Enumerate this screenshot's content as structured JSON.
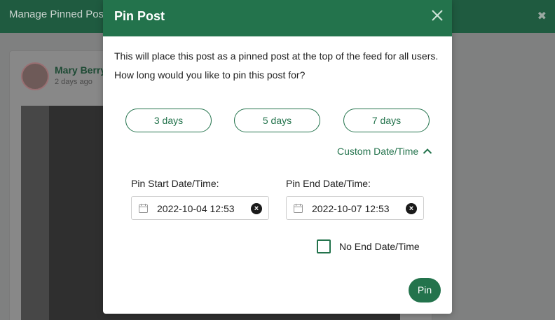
{
  "background": {
    "header_title": "Manage Pinned Posts",
    "close_symbol": "✖",
    "post": {
      "author": "Mary Berry",
      "time": "2 days ago"
    }
  },
  "modal": {
    "title": "Pin Post",
    "description": "This will place this post as a pinned post at the top of the feed for all users.",
    "question": "How long would you like to pin this post for?",
    "durations": [
      {
        "label": "3 days"
      },
      {
        "label": "5 days"
      },
      {
        "label": "7 days"
      }
    ],
    "custom_toggle_label": "Custom Date/Time",
    "custom_toggle_icon": "chevron-up-icon",
    "start": {
      "label": "Pin Start Date/Time:",
      "value": "2022-10-04 12:53"
    },
    "end": {
      "label": "Pin End Date/Time:",
      "value": "2022-10-07 12:53"
    },
    "no_end_label": "No End Date/Time",
    "no_end_checked": false,
    "pin_label": "Pin"
  },
  "colors": {
    "primary": "#23734c",
    "header_dim": "#1f5b40"
  }
}
